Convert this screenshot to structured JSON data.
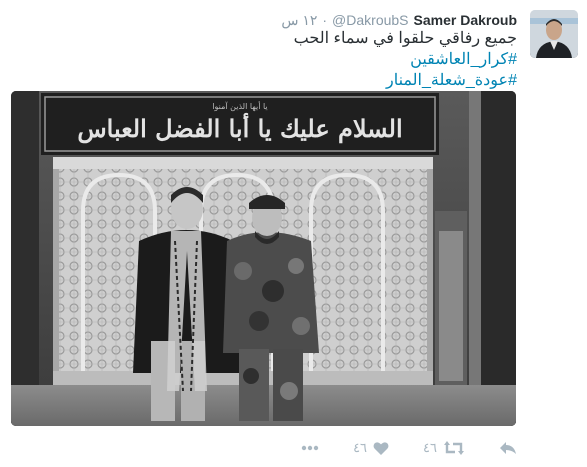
{
  "tweet": {
    "author_name": "Samer Dakroub",
    "author_handle": "@DakroubS",
    "separator": "·",
    "time": "١٢ س",
    "text_line": "جميع رفاقي حلقوا في سماء الحب",
    "hashtags": [
      "#كرار_العاشقين",
      "#عودة_شعلة_المنار"
    ],
    "photo_banner_text": "السلام عليك يا أبا الفضل العباس",
    "photo_banner_small_text": "يا أيها الذين آمنوا"
  },
  "actions": {
    "reply_icon": "reply-icon",
    "retweet_icon": "retweet-icon",
    "retweet_count": "٤٦",
    "like_icon": "heart-icon",
    "like_count": "٤٦",
    "more_icon": "more-dots-icon"
  }
}
